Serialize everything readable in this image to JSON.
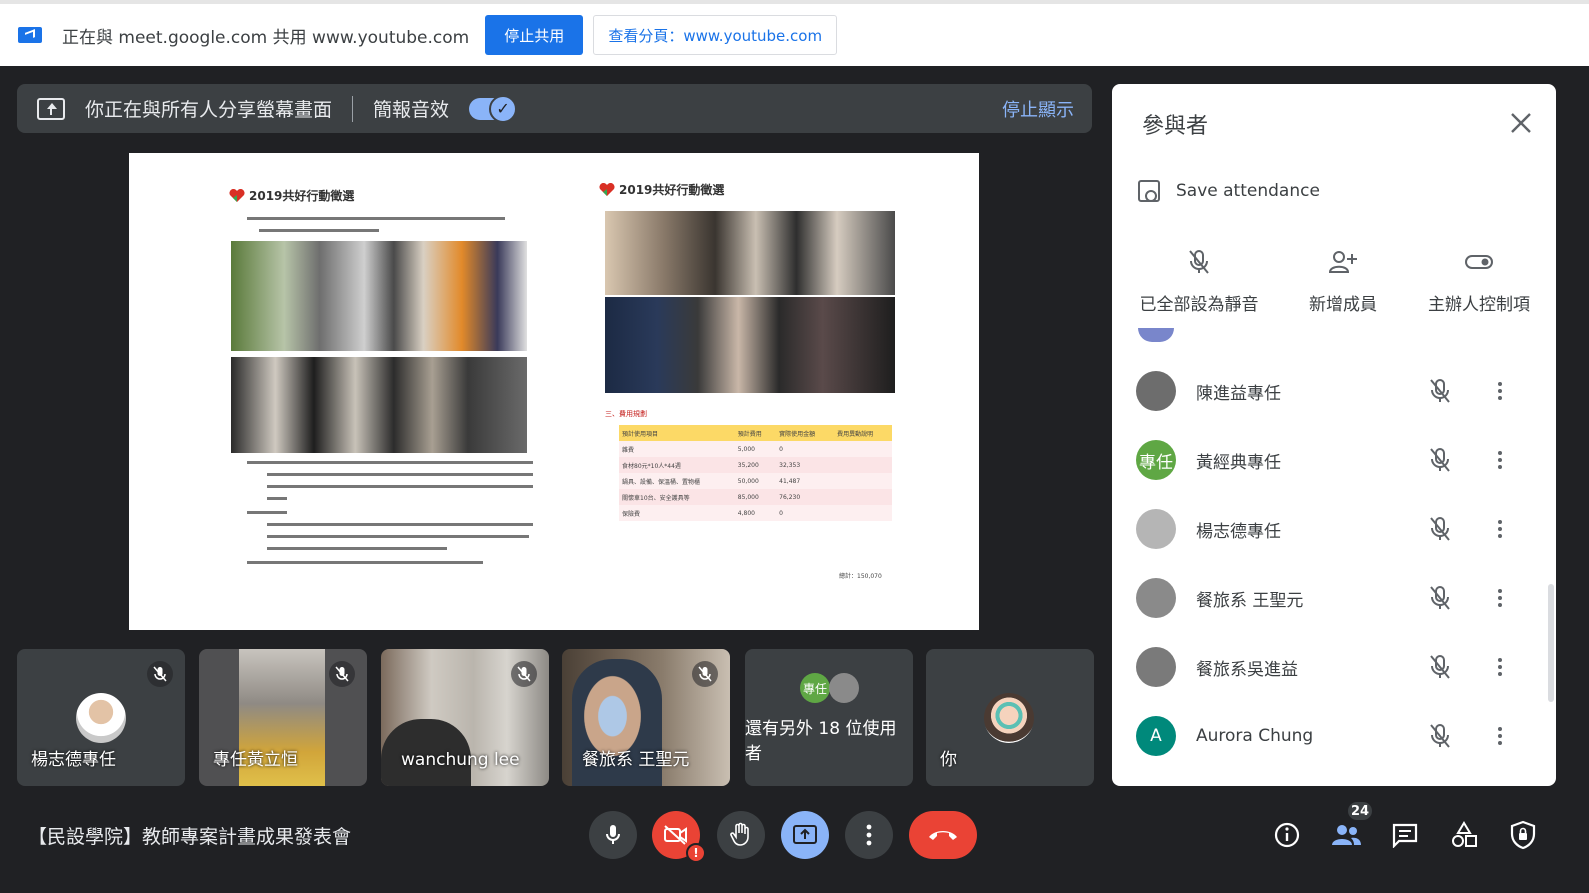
{
  "share_bar": {
    "text": "正在與 meet.google.com 共用 www.youtube.com",
    "stop_button": "停止共用",
    "view_tab_button": "查看分頁：www.youtube.com"
  },
  "presenting": {
    "text": "你正在與所有人分享螢幕畫面",
    "audio_label": "簡報音效",
    "audio_on": true,
    "stop_show": "停止顯示"
  },
  "slide": {
    "left_header": "2019共好行動徵選",
    "right_header": "2019共好行動徵選",
    "section_label": "三、費用規劃",
    "total": "總計：150,070",
    "budget_rows": [
      [
        "預計使用項目",
        "預計費用",
        "實際使用金額",
        "費用異動說明"
      ],
      [
        "雜費",
        "5,000",
        "0",
        ""
      ],
      [
        "食材80元*10人*44週",
        "35,200",
        "32,353",
        ""
      ],
      [
        "鍋具、設備、保溫桶、置物櫃",
        "50,000",
        "41,487",
        ""
      ],
      [
        "關懷車10台、安全護具等",
        "85,000",
        "76,230",
        ""
      ],
      [
        "保險費",
        "4,800",
        "0",
        ""
      ]
    ]
  },
  "tiles": [
    {
      "name": "楊志德專任"
    },
    {
      "name": "專任黃立恒"
    },
    {
      "name": "wanchung lee"
    },
    {
      "name": "餐旅系 王聖元"
    },
    {
      "name": "還有另外 18 位使用者",
      "avatar_text": "專任"
    },
    {
      "name": "你"
    }
  ],
  "meeting_title": "【民設學院】教師專案計畫成果發表會",
  "participant_count": "24",
  "panel": {
    "title": "參與者",
    "save_attendance": "Save attendance",
    "actions": {
      "mute_all": "已全部設為靜音",
      "add_people": "新增成員",
      "host_controls": "主辦人控制項"
    },
    "participants": [
      {
        "name": "陳進益專任",
        "avatar": "",
        "color": "#6d6d6d"
      },
      {
        "name": "黃經典專任",
        "avatar": "專任",
        "color": "#5fa744"
      },
      {
        "name": "楊志德專任",
        "avatar": "",
        "color": "#b5b5b5"
      },
      {
        "name": "餐旅系 王聖元",
        "avatar": "",
        "color": "#8a8a8a"
      },
      {
        "name": "餐旅系吳進益",
        "avatar": "",
        "color": "#7a7a7a"
      },
      {
        "name": "Aurora Chung",
        "avatar": "A",
        "color": "#00897b"
      }
    ]
  }
}
